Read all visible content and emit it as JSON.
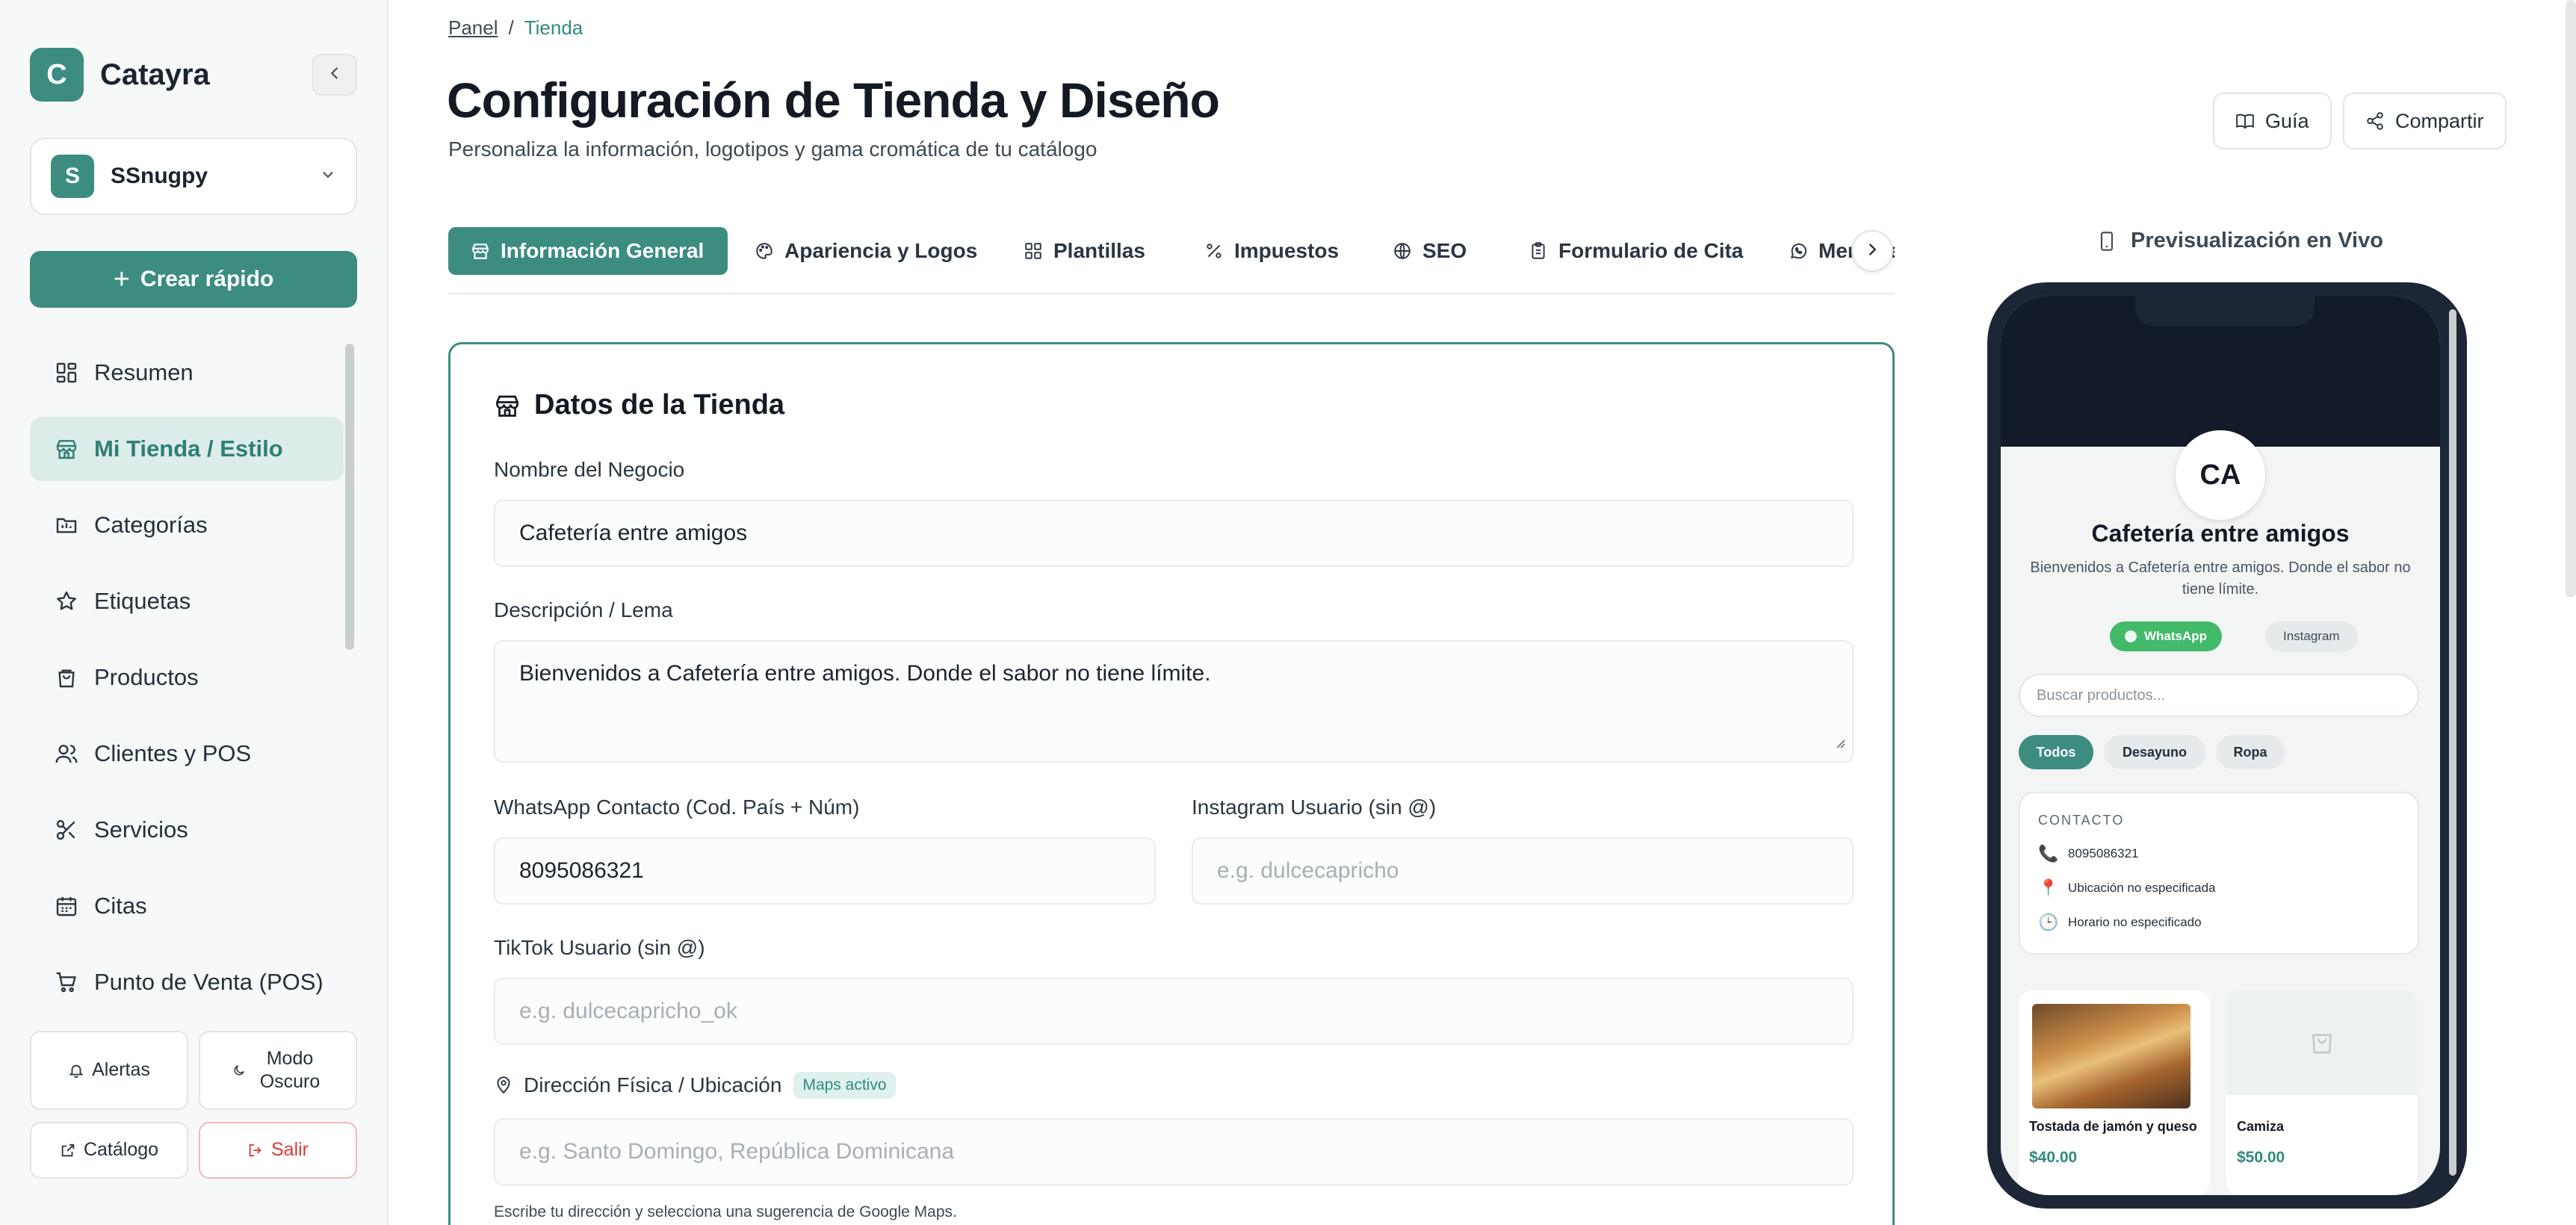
{
  "brand": {
    "initial": "C",
    "name": "Catayra"
  },
  "store_selector": {
    "initial": "S",
    "name": "SSnugpy"
  },
  "quick_create": {
    "label": "Crear rápido"
  },
  "nav": [
    {
      "label": "Resumen",
      "icon": "grid-icon"
    },
    {
      "label": "Mi Tienda / Estilo",
      "icon": "store-icon",
      "active": true
    },
    {
      "label": "Categorías",
      "icon": "folder-icon"
    },
    {
      "label": "Etiquetas",
      "icon": "star-icon"
    },
    {
      "label": "Productos",
      "icon": "bag-icon"
    },
    {
      "label": "Clientes y POS",
      "icon": "users-icon"
    },
    {
      "label": "Servicios",
      "icon": "scissors-icon"
    },
    {
      "label": "Citas",
      "icon": "calendar-icon"
    },
    {
      "label": "Punto de Venta (POS)",
      "icon": "cart-icon"
    }
  ],
  "bottom": {
    "alerts": "Alertas",
    "dark_mode": "Modo Oscuro",
    "catalog": "Catálogo",
    "logout": "Salir"
  },
  "breadcrumb": {
    "root": "Panel",
    "separator": "/",
    "current": "Tienda"
  },
  "header": {
    "title": "Configuración de Tienda y Diseño",
    "subtitle": "Personaliza la información, logotipos y gama cromática de tu catálogo",
    "guide": "Guía",
    "share": "Compartir"
  },
  "tabs": [
    {
      "label": "Información General",
      "icon": "store-icon",
      "active": true
    },
    {
      "label": "Apariencia y Logos",
      "icon": "palette-icon"
    },
    {
      "label": "Plantillas",
      "icon": "layout-icon"
    },
    {
      "label": "Impuestos",
      "icon": "percent-icon"
    },
    {
      "label": "SEO",
      "icon": "globe-icon"
    },
    {
      "label": "Formulario de Cita",
      "icon": "clipboard-icon"
    },
    {
      "label": "Mensajes",
      "icon": "whatsapp-icon"
    }
  ],
  "form": {
    "section_title": "Datos de la Tienda",
    "business_name": {
      "label": "Nombre del Negocio",
      "value": "Cafetería entre amigos"
    },
    "description": {
      "label": "Descripción / Lema",
      "value": "Bienvenidos a Cafetería entre amigos. Donde el sabor no tiene límite."
    },
    "whatsapp": {
      "label": "WhatsApp Contacto (Cod. País + Núm)",
      "value": "8095086321"
    },
    "instagram": {
      "label": "Instagram Usuario (sin @)",
      "placeholder": "e.g. dulcecapricho"
    },
    "tiktok": {
      "label": "TikTok Usuario (sin @)",
      "placeholder": "e.g. dulcecapricho_ok"
    },
    "address": {
      "label": "Dirección Física / Ubicación",
      "badge": "Maps activo",
      "placeholder": "e.g. Santo Domingo, República Dominicana",
      "help": "Escribe tu dirección y selecciona una sugerencia de Google Maps."
    }
  },
  "preview": {
    "label": "Previsualización en Vivo",
    "avatar": "CA",
    "store_name": "Cafetería entre amigos",
    "description": "Bienvenidos a Cafetería entre amigos. Donde el sabor no tiene límite.",
    "whatsapp_chip": "WhatsApp",
    "instagram_chip": "Instagram",
    "search_placeholder": "Buscar productos...",
    "categories": [
      "Todos",
      "Desayuno",
      "Ropa"
    ],
    "contact": {
      "heading": "CONTACTO",
      "phone": "8095086321",
      "location": "Ubicación no especificada",
      "hours": "Horario no especificado"
    },
    "products": [
      {
        "name": "Tostada de jamón y queso",
        "price": "$40.00"
      },
      {
        "name": "Camiza",
        "price": "$50.00"
      }
    ]
  },
  "colors": {
    "accent": "#3c8c80",
    "danger": "#d93a3a",
    "phone_frame": "#1c2636"
  }
}
